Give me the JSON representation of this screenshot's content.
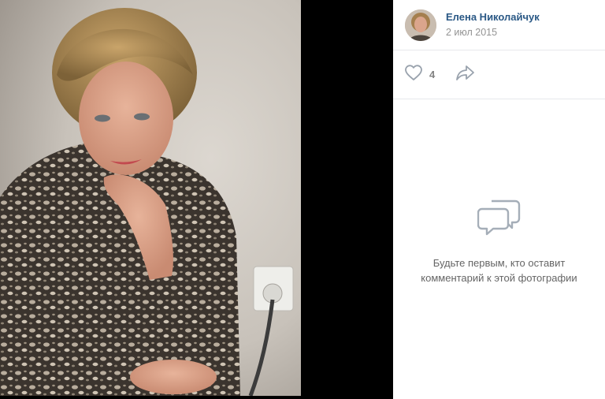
{
  "author": {
    "name": "Елена Николайчук",
    "date": "2 июл 2015"
  },
  "actions": {
    "likes": "4",
    "like_icon": "heart-icon",
    "share_icon": "share-arrow-icon"
  },
  "comments": {
    "icon": "chat-bubbles-icon",
    "empty_message": "Будьте первым, кто оставит комментарий к этой фотографии"
  },
  "colors": {
    "link": "#2a5885",
    "muted": "#939393",
    "icon": "#99a2ad",
    "viewer_bg": "#000000"
  }
}
